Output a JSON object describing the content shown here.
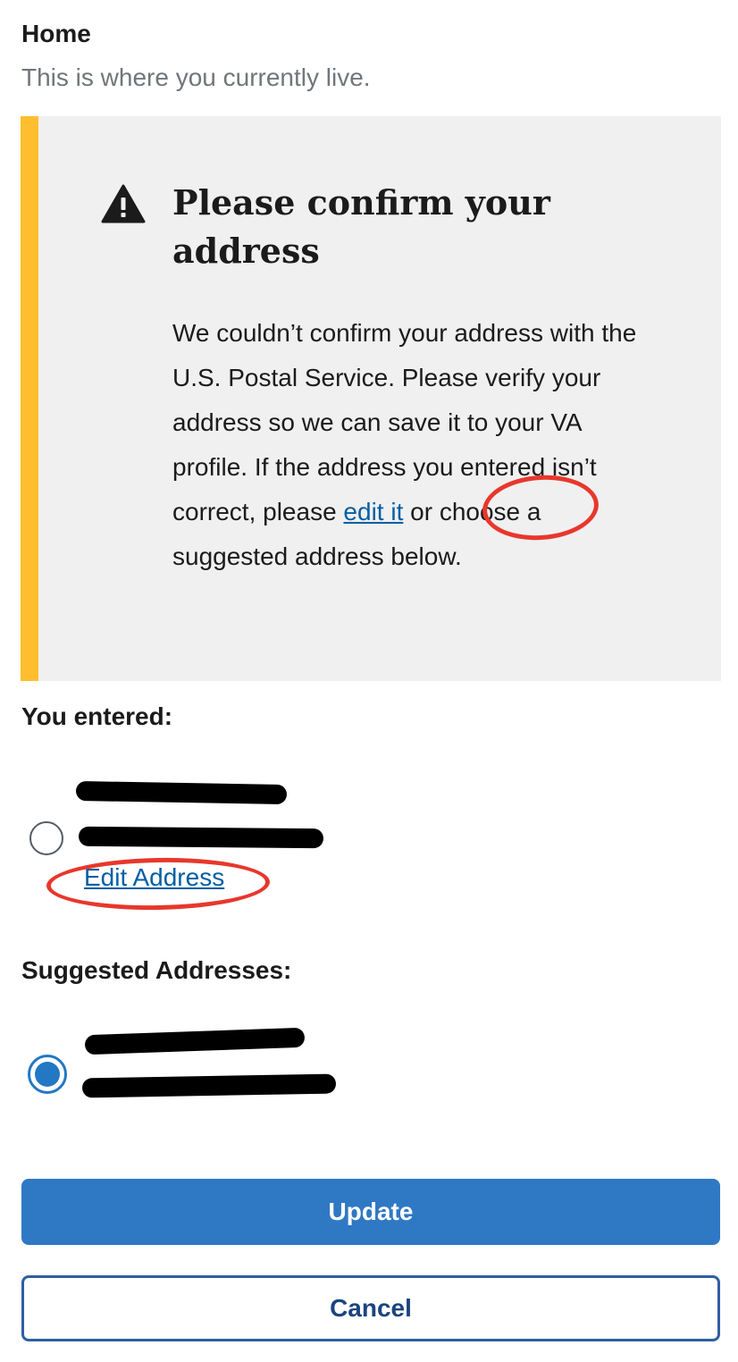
{
  "section": {
    "title": "Home",
    "subtitle": "This is where you currently live."
  },
  "alert": {
    "icon": "warning-icon",
    "heading": "Please confirm your address",
    "body_before_link": "We couldn’t confirm your address with the U.S. Postal Service. Please verify your address so we can save it to your VA profile. If the address you entered isn’t correct, please ",
    "link_text": "edit it",
    "body_after_link": " or choose a suggested address below.",
    "accent_color": "#ffbe2e"
  },
  "entered": {
    "label": "You entered:",
    "edit_link": "Edit Address",
    "selected": false
  },
  "suggested": {
    "label": "Suggested Addresses:",
    "selected": true
  },
  "buttons": {
    "update": "Update",
    "cancel": "Cancel"
  },
  "colors": {
    "primary": "#2f78c4",
    "link": "#005ea2",
    "annotation": "#e8372c"
  }
}
